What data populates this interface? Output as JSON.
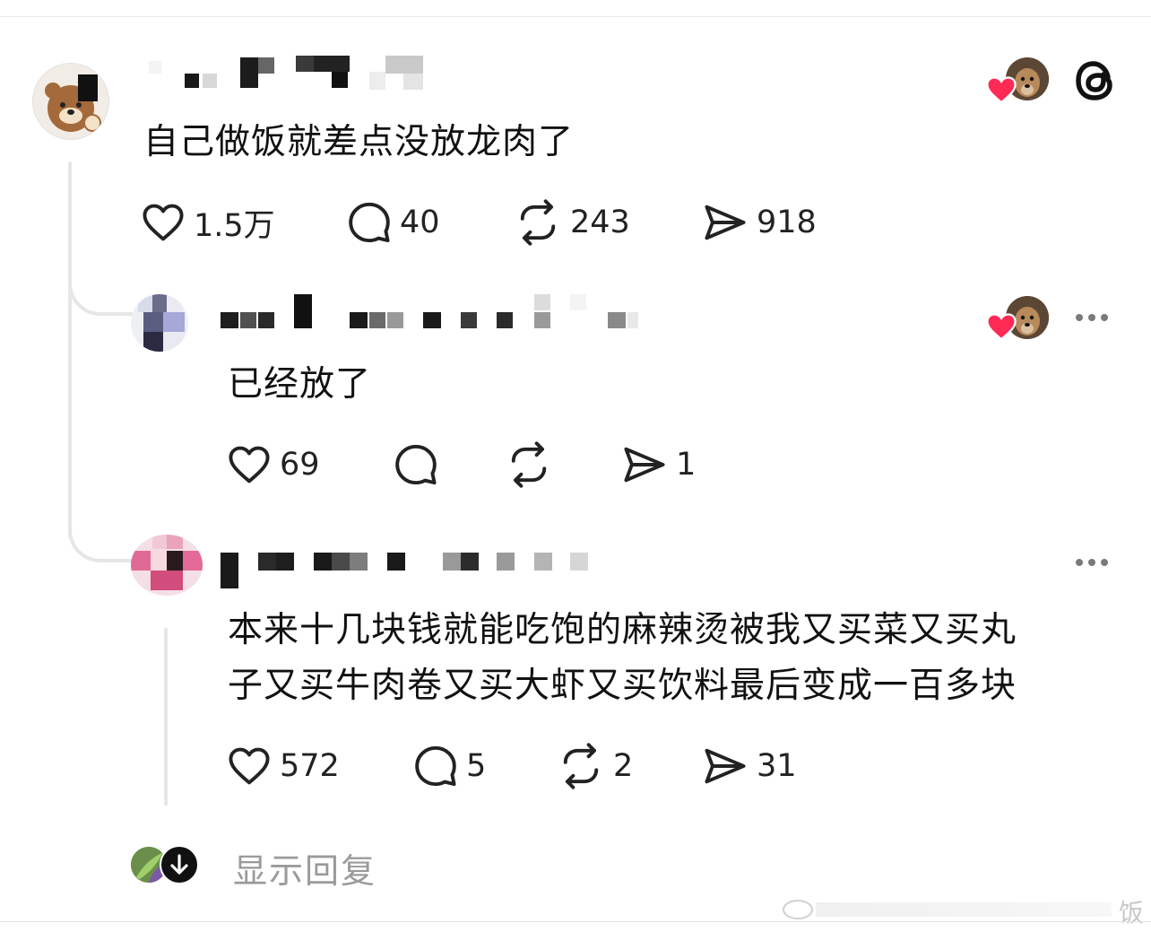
{
  "app": {
    "brand_icon": "threads-logo"
  },
  "post": {
    "text": "自己做饭就差点没放龙肉了",
    "likes": "1.5万",
    "comments": "40",
    "reposts": "243",
    "shares": "918"
  },
  "reply1": {
    "text": "已经放了",
    "likes": "69",
    "comments": "",
    "reposts": "",
    "shares": "1"
  },
  "reply2": {
    "text_line1": "本来十几块钱就能吃饱的麻辣烫被我又买菜又买丸",
    "text_line2": "子又买牛肉卷又买大虾又买饮料最后变成一百多块",
    "likes": "572",
    "comments": "5",
    "reposts": "2",
    "shares": "31"
  },
  "footer": {
    "show_replies": "显示回复",
    "watermark": "饭"
  },
  "colors": {
    "heart": "#ff2b55",
    "text": "#111111",
    "muted": "#9a9a9a",
    "thread_line": "#e6e6e6"
  }
}
